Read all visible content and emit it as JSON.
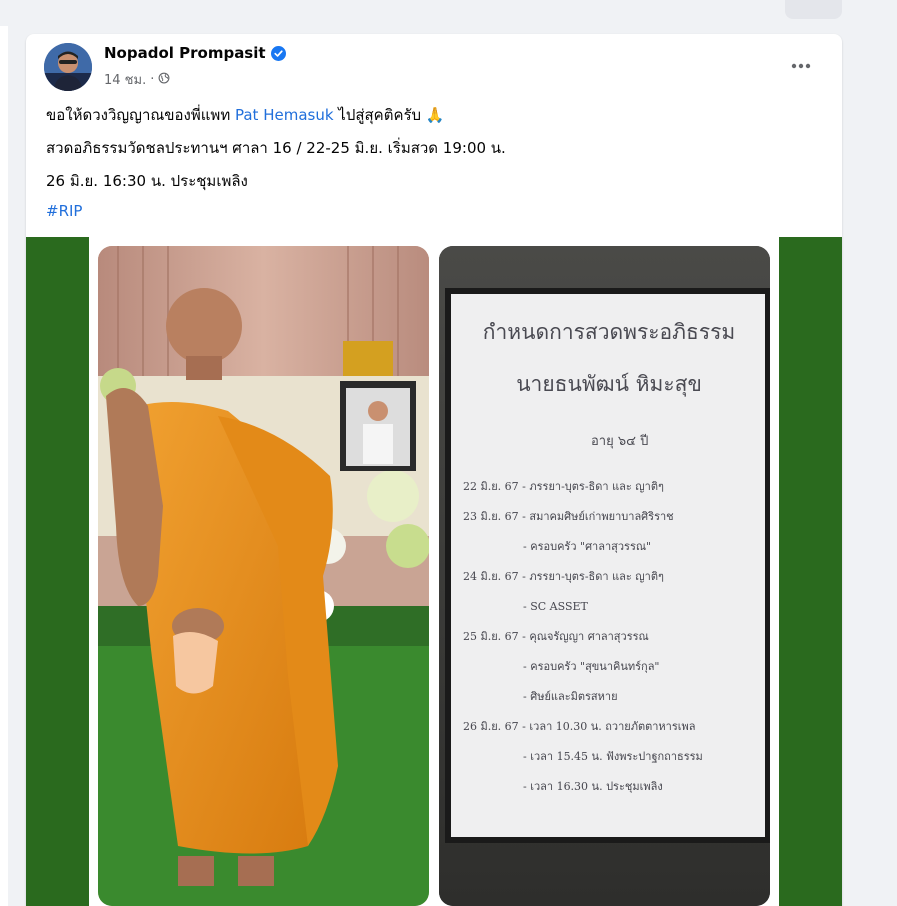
{
  "post": {
    "author": "Nopadol Prompasit",
    "time": "14 ชม.",
    "time_separator": "·",
    "line1_prefix": "ขอให้ดวงวิญญาณของพี่แพท ",
    "line1_link": "Pat Hemasuk",
    "line1_suffix": " ไปสู่สุคติครับ 🙏",
    "line2": "สวดอภิธรรมวัดชลประทานฯ ศาลา 16 / 22-25 มิ.ย. เริ่มสวด 19:00 น.",
    "line3": "26 มิ.ย. 16:30 น. ประชุมเพลิง",
    "hashtag": "#RIP"
  },
  "board": {
    "title1": "กำหนดการสวดพระอภิธรรม",
    "title2": "นายธนพัฒน์ หิมะสุข",
    "age": "อายุ ๖๔ ปี",
    "rows": [
      "22 มิ.ย. 67 - ภรรยา-บุตร-ธิดา และ ญาติๆ",
      "23 มิ.ย. 67 - สมาคมศิษย์เก่าพยาบาลศิริราช",
      "- ครอบครัว \"ศาลาสุวรรณ\"",
      "24 มิ.ย. 67 - ภรรยา-บุตร-ธิดา และ ญาติๆ",
      "- SC ASSET",
      "25 มิ.ย. 67 - คุณจรัญญา ศาลาสุวรรณ",
      "- ครอบครัว \"สุขนาคินทร์กุล\"",
      "- ศิษย์และมิตรสหาย",
      "26 มิ.ย. 67 - เวลา 10.30 น. ถวายภัตตาหารเพล",
      "- เวลา 15.45 น. ฟังพระปาฐกถาธรรม",
      "- เวลา 16.30 น. ประชุมเพลิง"
    ]
  },
  "colors": {
    "link": "#216fdb",
    "verified": "#1877f2",
    "robe": "#e8901e",
    "media_bg": "#2a6a1e"
  },
  "icons": {
    "verified": "verified-badge-icon",
    "privacy": "globe-icon",
    "more": "more-options-icon"
  }
}
